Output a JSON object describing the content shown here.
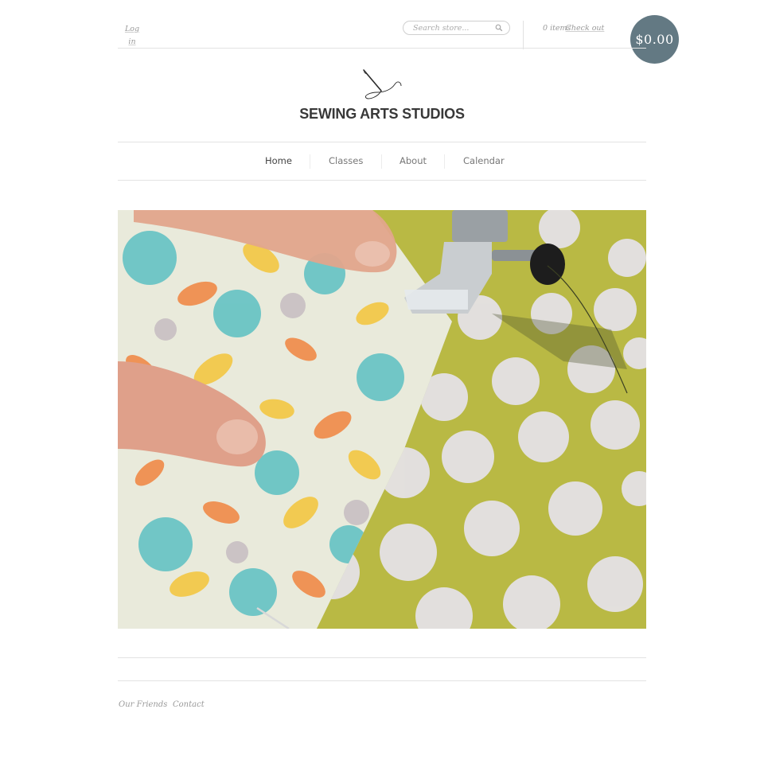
{
  "header": {
    "login_label": "Log in",
    "search_placeholder": "Search store...",
    "cart_items": "0 items",
    "checkout_label": "Check out",
    "cart_total": "$0.00"
  },
  "site": {
    "title": "SEWING ARTS STUDIOS",
    "logo_icon": "needle-and-thread-icon"
  },
  "nav": {
    "items": [
      {
        "label": "Home"
      },
      {
        "label": "Classes"
      },
      {
        "label": "About"
      },
      {
        "label": "Calendar"
      }
    ]
  },
  "hero": {
    "image": "sewing-machine-presser-foot-on-floral-and-polka-dot-fabric"
  },
  "footer": {
    "links": [
      {
        "label": "Our Friends"
      },
      {
        "label": "Contact"
      }
    ]
  },
  "colors": {
    "cart_badge": "#637983",
    "hairline": "#e3e3e3"
  }
}
